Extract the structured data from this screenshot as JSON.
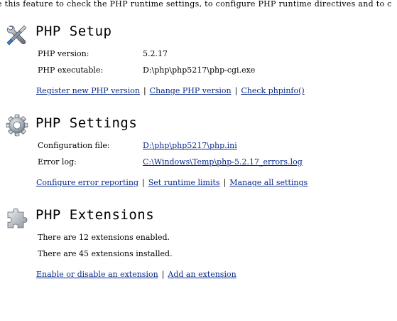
{
  "intro": "e this feature to check the PHP runtime settings, to configure PHP runtime directives and to c",
  "setup": {
    "title": "PHP Setup",
    "version_label": "PHP version:",
    "version_value": "5.2.17",
    "executable_label": "PHP executable:",
    "executable_value": "D:\\php\\php5217\\php-cgi.exe",
    "links": {
      "register": "Register new PHP version",
      "change": "Change PHP version",
      "phpinfo": "Check phpinfo()"
    }
  },
  "settings": {
    "title": "PHP Settings",
    "config_label": "Configuration file:",
    "config_value": "D:\\php\\php5217\\php.ini",
    "errorlog_label": "Error log:",
    "errorlog_value": "C:\\Windows\\Temp\\php-5.2.17_errors.log",
    "links": {
      "error_reporting": "Configure error reporting",
      "runtime_limits": "Set runtime limits",
      "manage_all": "Manage all settings"
    }
  },
  "extensions": {
    "title": "PHP Extensions",
    "enabled_text": "There are 12 extensions enabled.",
    "installed_text": "There are 45 extensions installed.",
    "links": {
      "enable_disable": "Enable or disable an extension",
      "add": "Add an extension"
    }
  },
  "icons": {
    "setup": "tools-icon",
    "settings": "gear-icon",
    "extensions": "puzzle-piece-icon"
  }
}
